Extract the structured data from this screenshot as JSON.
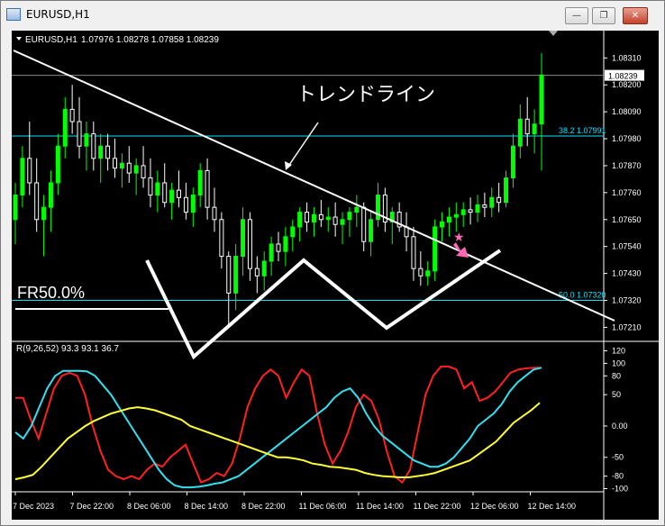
{
  "window": {
    "title": "EURUSD,H1",
    "minimize_icon": "minimize-icon",
    "restore_icon": "restore-icon",
    "close_icon": "close-icon"
  },
  "chart_header": {
    "symbol_label": "EURUSD,H1",
    "ohlc": "1.07976 1.08278 1.07858 1.08239"
  },
  "annotations": {
    "trendline_label": "トレンドライン",
    "fr_label": "FR50.0%"
  },
  "colors": {
    "up": "#00ff00",
    "down": "#ffffff",
    "level": "#00e5ff",
    "trendline": "#ffffff",
    "zigzag": "#ffffff",
    "arrow": "#ff69b4",
    "red_line": "#ff2020",
    "cyan_line": "#33e0f0",
    "yellow_line": "#ffff33"
  },
  "chart_data": [
    {
      "type": "candlestick",
      "ylim": [
        1.0716,
        1.0837
      ],
      "price_labels": [
        "1.08310",
        "1.08200",
        "1.08090",
        "1.07980",
        "1.07870",
        "1.07760",
        "1.07650",
        "1.07540",
        "1.07430",
        "1.07320",
        "1.07210"
      ],
      "current_price": "1.08239",
      "fib_levels": [
        {
          "label": "38.2",
          "value": "1.07991"
        },
        {
          "label": "50.0",
          "value": "1.07320"
        }
      ],
      "candles": [
        [
          1.0765,
          1.078,
          1.0755,
          1.0775
        ],
        [
          1.0775,
          1.0795,
          1.077,
          1.079
        ],
        [
          1.079,
          1.0805,
          1.0775,
          1.078
        ],
        [
          1.078,
          1.079,
          1.076,
          1.0765
        ],
        [
          1.0765,
          1.0775,
          1.075,
          1.077
        ],
        [
          1.077,
          1.0785,
          1.076,
          1.078
        ],
        [
          1.078,
          1.08,
          1.0775,
          1.0795
        ],
        [
          1.0795,
          1.0815,
          1.079,
          1.081
        ],
        [
          1.081,
          1.082,
          1.08,
          1.0805
        ],
        [
          1.0805,
          1.0815,
          1.079,
          1.0795
        ],
        [
          1.0795,
          1.0805,
          1.0785,
          1.08
        ],
        [
          1.08,
          1.0805,
          1.0785,
          1.079
        ],
        [
          1.079,
          1.08,
          1.078,
          1.0795
        ],
        [
          1.0795,
          1.08,
          1.0785,
          1.079
        ],
        [
          1.079,
          1.0798,
          1.0782,
          1.0786
        ],
        [
          1.0786,
          1.0792,
          1.0778,
          1.0788
        ],
        [
          1.0788,
          1.0795,
          1.078,
          1.0784
        ],
        [
          1.0784,
          1.079,
          1.0775,
          1.0787
        ],
        [
          1.0787,
          1.0795,
          1.0778,
          1.0782
        ],
        [
          1.0782,
          1.079,
          1.077,
          1.0775
        ],
        [
          1.0775,
          1.0785,
          1.0768,
          1.078
        ],
        [
          1.078,
          1.0788,
          1.077,
          1.0772
        ],
        [
          1.0772,
          1.078,
          1.0765,
          1.0777
        ],
        [
          1.0777,
          1.0785,
          1.077,
          1.0774
        ],
        [
          1.0774,
          1.078,
          1.0765,
          1.0768
        ],
        [
          1.0768,
          1.0778,
          1.0762,
          1.0775
        ],
        [
          1.0775,
          1.0788,
          1.077,
          1.0785
        ],
        [
          1.0785,
          1.079,
          1.0765,
          1.077
        ],
        [
          1.077,
          1.0778,
          1.076,
          1.0765
        ],
        [
          1.0765,
          1.0768,
          1.0745,
          1.075
        ],
        [
          1.075,
          1.0752,
          1.0722,
          1.0735
        ],
        [
          1.0735,
          1.0755,
          1.0728,
          1.075
        ],
        [
          1.075,
          1.077,
          1.0742,
          1.0765
        ],
        [
          1.0765,
          1.0768,
          1.074,
          1.0745
        ],
        [
          1.0745,
          1.075,
          1.0735,
          1.0742
        ],
        [
          1.0742,
          1.0752,
          1.0736,
          1.0748
        ],
        [
          1.0748,
          1.0758,
          1.0742,
          1.0755
        ],
        [
          1.0755,
          1.076,
          1.0748,
          1.0752
        ],
        [
          1.0752,
          1.0762,
          1.0746,
          1.0758
        ],
        [
          1.0758,
          1.0765,
          1.0752,
          1.0762
        ],
        [
          1.0762,
          1.077,
          1.0756,
          1.0768
        ],
        [
          1.0768,
          1.0772,
          1.076,
          1.0764
        ],
        [
          1.0764,
          1.077,
          1.0758,
          1.0767
        ],
        [
          1.0767,
          1.0773,
          1.0762,
          1.0765
        ],
        [
          1.0765,
          1.077,
          1.076,
          1.0766
        ],
        [
          1.0766,
          1.0772,
          1.0758,
          1.0763
        ],
        [
          1.0763,
          1.0768,
          1.0755,
          1.0765
        ],
        [
          1.0765,
          1.077,
          1.0758,
          1.0768
        ],
        [
          1.0768,
          1.0775,
          1.0762,
          1.077
        ],
        [
          1.077,
          1.0772,
          1.0752,
          1.0756
        ],
        [
          1.0756,
          1.0768,
          1.075,
          1.0765
        ],
        [
          1.0765,
          1.078,
          1.0762,
          1.0775
        ],
        [
          1.0775,
          1.0778,
          1.076,
          1.0764
        ],
        [
          1.0764,
          1.077,
          1.0755,
          1.0768
        ],
        [
          1.0768,
          1.0772,
          1.076,
          1.0762
        ],
        [
          1.0762,
          1.0768,
          1.0752,
          1.0758
        ],
        [
          1.0758,
          1.0762,
          1.074,
          1.0745
        ],
        [
          1.0745,
          1.0752,
          1.0738,
          1.0742
        ],
        [
          1.0742,
          1.0748,
          1.0738,
          1.0744
        ],
        [
          1.0744,
          1.0765,
          1.074,
          1.0762
        ],
        [
          1.0762,
          1.0768,
          1.0756,
          1.0764
        ],
        [
          1.0764,
          1.077,
          1.0758,
          1.0766
        ],
        [
          1.0766,
          1.0772,
          1.076,
          1.0767
        ],
        [
          1.0767,
          1.0772,
          1.0762,
          1.0769
        ],
        [
          1.0769,
          1.0774,
          1.0763,
          1.0768
        ],
        [
          1.0768,
          1.0775,
          1.0764,
          1.0771
        ],
        [
          1.0771,
          1.0776,
          1.0766,
          1.077
        ],
        [
          1.077,
          1.0778,
          1.0766,
          1.0774
        ],
        [
          1.0774,
          1.078,
          1.0768,
          1.0772
        ],
        [
          1.0772,
          1.0785,
          1.077,
          1.0782
        ],
        [
          1.0782,
          1.08,
          1.0778,
          1.0795
        ],
        [
          1.0795,
          1.0812,
          1.079,
          1.0806
        ],
        [
          1.0806,
          1.0815,
          1.0795,
          1.08
        ],
        [
          1.08,
          1.081,
          1.0792,
          1.0804
        ],
        [
          1.0804,
          1.0833,
          1.0785,
          1.0824
        ]
      ]
    },
    {
      "type": "line",
      "indicator_label": "R(9,26,52) 93.3 93.1 36.7",
      "ylim": [
        -105,
        125
      ],
      "y_tick_labels": [
        "120",
        "100",
        "80",
        "50",
        "0.00",
        "-50",
        "-80",
        "-100"
      ],
      "y_ticks": [
        120,
        100,
        80,
        50,
        0,
        -50,
        -80,
        -100
      ],
      "x_labels": [
        "7 Dec 2023",
        "7 Dec 22:00",
        "8 Dec 06:00",
        "8 Dec 14:00",
        "8 Dec 22:00",
        "11 Dec 06:00",
        "11 Dec 14:00",
        "11 Dec 22:00",
        "12 Dec 06:00",
        "12 Dec 14:00"
      ],
      "series": [
        {
          "values": [
            45,
            45,
            10,
            -20,
            20,
            60,
            80,
            85,
            80,
            50,
            0,
            -40,
            -70,
            -80,
            -85,
            -80,
            -85,
            -70,
            -60,
            -65,
            -50,
            -40,
            -30,
            -60,
            -90,
            -85,
            -75,
            -80,
            -60,
            -20,
            30,
            60,
            80,
            90,
            80,
            45,
            70,
            90,
            80,
            20,
            -30,
            -60,
            -40,
            -10,
            30,
            50,
            40,
            10,
            -40,
            -80,
            -90,
            -70,
            -10,
            50,
            80,
            95,
            95,
            90,
            60,
            70,
            40,
            45,
            55,
            70,
            85,
            90,
            92,
            93,
            93
          ]
        },
        {
          "values": [
            -10,
            -20,
            0,
            30,
            60,
            80,
            88,
            88,
            88,
            87,
            80,
            65,
            50,
            30,
            10,
            -10,
            -30,
            -50,
            -70,
            -85,
            -95,
            -98,
            -98,
            -97,
            -95,
            -92,
            -90,
            -85,
            -80,
            -70,
            -60,
            -50,
            -40,
            -30,
            -20,
            -10,
            0,
            10,
            20,
            30,
            45,
            55,
            60,
            45,
            20,
            0,
            -15,
            -25,
            -35,
            -45,
            -55,
            -60,
            -65,
            -65,
            -60,
            -50,
            -35,
            -20,
            0,
            10,
            20,
            35,
            55,
            70,
            80,
            90,
            93
          ]
        },
        {
          "values": [
            -85,
            -82,
            -78,
            -65,
            -50,
            -35,
            -20,
            -10,
            0,
            8,
            14,
            20,
            24,
            28,
            30,
            28,
            25,
            20,
            15,
            10,
            0,
            -5,
            -10,
            -15,
            -20,
            -25,
            -30,
            -35,
            -40,
            -45,
            -50,
            -50,
            -52,
            -55,
            -60,
            -62,
            -65,
            -66,
            -68,
            -70,
            -75,
            -78,
            -80,
            -81,
            -82,
            -82,
            -80,
            -78,
            -75,
            -70,
            -65,
            -60,
            -55,
            -45,
            -35,
            -25,
            -10,
            5,
            15,
            25,
            37
          ]
        }
      ]
    }
  ]
}
